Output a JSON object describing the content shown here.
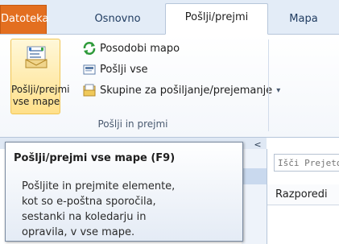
{
  "tabs": {
    "file": "Datoteka",
    "home": "Osnovno",
    "send_receive": "Pošlji/prejmi",
    "folder": "Mapa"
  },
  "ribbon": {
    "big_button": {
      "line1": "Pošlji/prejmi",
      "line2": "vse mape",
      "icon": "send-receive-all-icon"
    },
    "small_buttons": [
      {
        "label": "Posodobi mapo",
        "icon": "update-folder-icon"
      },
      {
        "label": "Pošlji vse",
        "icon": "send-all-icon"
      },
      {
        "label": "Skupine za pošiljanje/prejemanje",
        "icon": "send-receive-groups-icon",
        "dropdown_glyph": "▾"
      }
    ],
    "group_label": "Pošlji in prejmi"
  },
  "nav": {
    "collapse_glyph": "<"
  },
  "search": {
    "placeholder": "Išči Prejeto"
  },
  "arrange": {
    "label": "Razporedi"
  },
  "tooltip": {
    "title": "Pošlji/prejmi vse mape (F9)",
    "lines": [
      "Pošljite in prejmite elemente,",
      "kot so e-poštna sporočila,",
      "sestanki na koledarju in",
      "opravila, v vse mape."
    ]
  },
  "colors": {
    "file_tab": "#e36f20",
    "ribbon_highlight": "#ffe08a",
    "accent": "#1e3a5f"
  }
}
